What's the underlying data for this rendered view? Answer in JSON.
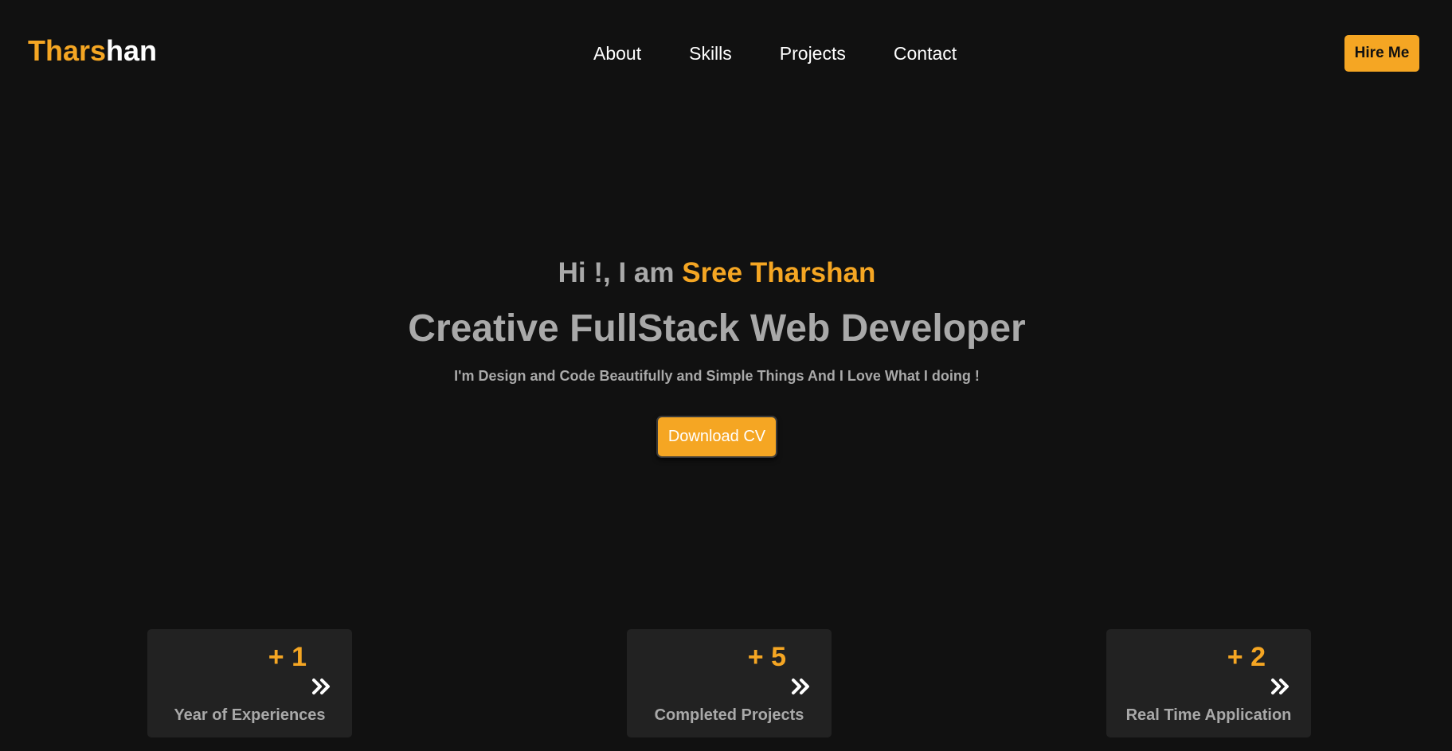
{
  "header": {
    "logo_accent": "Thars",
    "logo_rest": "han",
    "nav": [
      "About",
      "Skills",
      "Projects",
      "Contact"
    ],
    "hire_label": "Hire Me"
  },
  "hero": {
    "greeting_prefix": "Hi !, I am ",
    "greeting_name": "Sree Tharshan",
    "headline": "Creative FullStack Web Developer",
    "tagline": "I'm Design and Code Beautifully and Simple Things And I Love What I doing !",
    "download_label": "Download CV"
  },
  "stats": [
    {
      "value": "+ 1",
      "label": "Year of Experiences",
      "icon": "double-chevron-right-icon"
    },
    {
      "value": "+ 5",
      "label": "Completed Projects",
      "icon": "double-chevron-right-icon"
    },
    {
      "value": "+ 2",
      "label": "Real Time Application",
      "icon": "double-chevron-right-icon"
    }
  ],
  "colors": {
    "background": "#111111",
    "accent": "#f5a623",
    "card": "#222222",
    "muted_text": "#a9a9a9"
  }
}
